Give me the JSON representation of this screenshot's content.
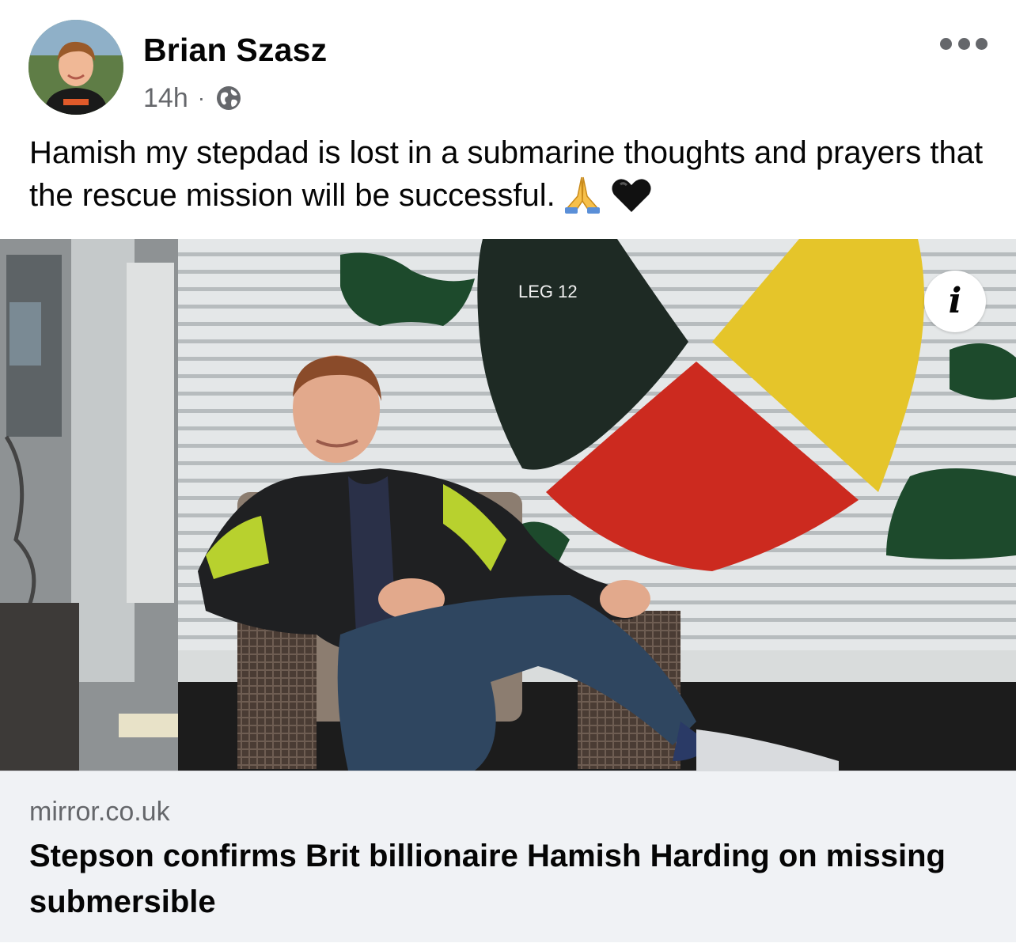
{
  "post": {
    "author": "Brian Szasz",
    "time": "14h",
    "separator": "·",
    "audience_icon": "globe-icon",
    "more_icon": "more-options-icon",
    "text": "Hamish my stepdad is lost in a submarine thoughts and prayers that the rescue mission will be successful.",
    "emojis": [
      "folded-hands-emoji",
      "black-heart-emoji"
    ]
  },
  "image": {
    "mural_label": "LEG 12",
    "info_label": "i"
  },
  "link": {
    "domain": "mirror.co.uk",
    "title": "Stepson confirms Brit billionaire Hamish Harding on missing submersible"
  },
  "colors": {
    "text_primary": "#050505",
    "text_secondary": "#65676b",
    "card_background": "#f0f2f5"
  }
}
